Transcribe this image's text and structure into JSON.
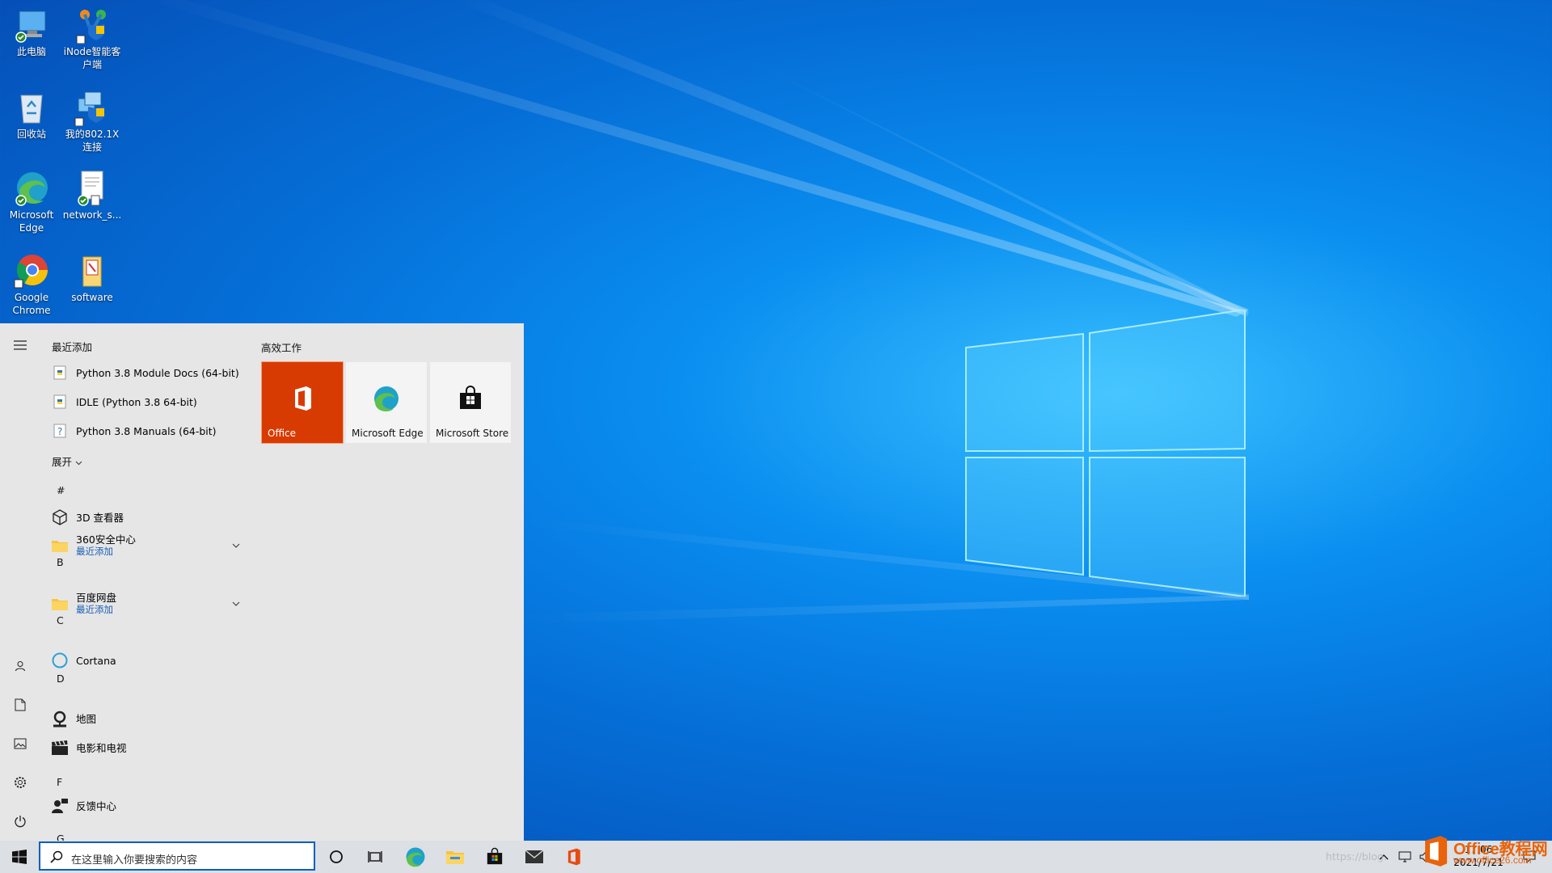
{
  "desktop": {
    "icons": [
      {
        "label": "此电脑"
      },
      {
        "label": "iNode智能客户端"
      },
      {
        "label": "回收站"
      },
      {
        "label": "我的802.1X连接"
      },
      {
        "label": "Microsoft Edge"
      },
      {
        "label": "network_s..."
      },
      {
        "label": "Google Chrome"
      },
      {
        "label": "software"
      }
    ]
  },
  "start_menu": {
    "recent_header": "最近添加",
    "recent_apps": [
      {
        "label": "Python 3.8 Module Docs (64-bit)"
      },
      {
        "label": "IDLE (Python 3.8 64-bit)"
      },
      {
        "label": "Python 3.8 Manuals (64-bit)"
      }
    ],
    "expand_label": "展开",
    "groups": [
      {
        "letter": "#"
      },
      {
        "letter": "B"
      },
      {
        "letter": "C"
      },
      {
        "letter": "D"
      },
      {
        "letter": "F"
      },
      {
        "letter": "G"
      }
    ],
    "apps": [
      {
        "label": "3D 查看器"
      },
      {
        "label": "360安全中心",
        "sub": "最近添加"
      },
      {
        "label": "百度网盘",
        "sub": "最近添加"
      },
      {
        "label": "Cortana"
      },
      {
        "label": "地图"
      },
      {
        "label": "电影和电视"
      },
      {
        "label": "反馈中心"
      }
    ],
    "tiles_header": "高效工作",
    "tiles": [
      {
        "label": "Office"
      },
      {
        "label": "Microsoft Edge"
      },
      {
        "label": "Microsoft Store"
      }
    ]
  },
  "taskbar": {
    "search_placeholder": "在这里输入你要搜索的内容",
    "clock_time": "17:06",
    "clock_date": "2021/7/21",
    "watermark_url": "https://blog.",
    "watermark_brand": "Office教程网",
    "watermark_site": "www.office26.com"
  },
  "colors": {
    "office_tile": "#d83b01",
    "accent": "#0060c0",
    "start_bg": "#e6e6e6"
  }
}
